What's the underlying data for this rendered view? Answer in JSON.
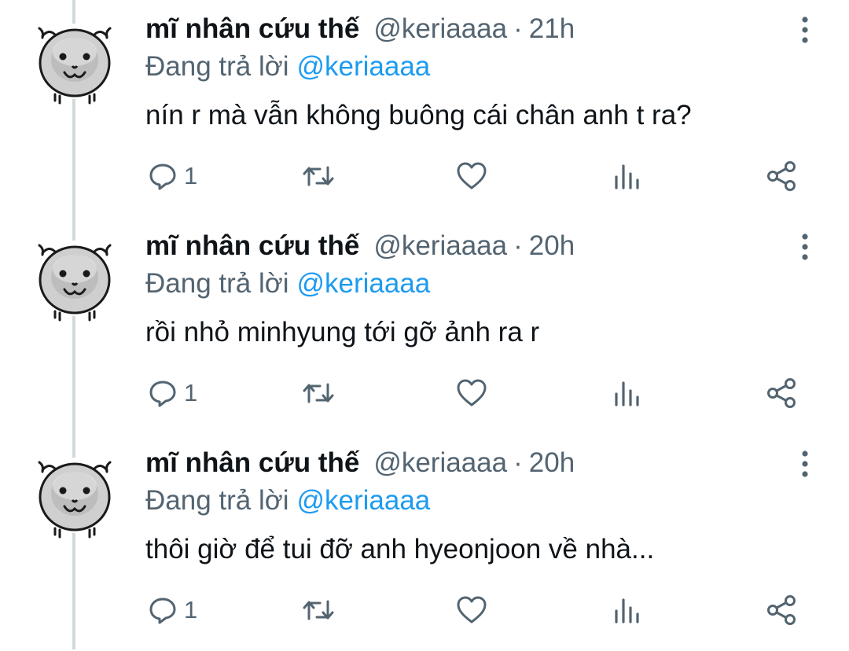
{
  "colors": {
    "text": "#0f1419",
    "secondary": "#536471",
    "mention": "#1d9bf0",
    "thread_line": "#cfd9de"
  },
  "icons": [
    "avatar-cat-icon",
    "more-vertical-icon",
    "reply-icon",
    "retweet-icon",
    "like-icon",
    "views-icon",
    "share-icon"
  ],
  "tweets": [
    {
      "name": "mĩ nhân cứu thế",
      "handle": "@keriaaaa",
      "time": "21h",
      "reply_prefix": "Đang trả lời",
      "reply_handle": "@keriaaaa",
      "text": "nín r mà vẫn không buông cái chân anh t ra?",
      "reply_count": "1"
    },
    {
      "name": "mĩ nhân cứu thế",
      "handle": "@keriaaaa",
      "time": "20h",
      "reply_prefix": "Đang trả lời",
      "reply_handle": "@keriaaaa",
      "text": "rồi nhỏ minhyung tới gỡ ảnh ra r",
      "reply_count": "1"
    },
    {
      "name": "mĩ nhân cứu thế",
      "handle": "@keriaaaa",
      "time": "20h",
      "reply_prefix": "Đang trả lời",
      "reply_handle": "@keriaaaa",
      "text": "thôi giờ để tui đỡ anh hyeonjoon về nhà...",
      "reply_count": "1"
    }
  ]
}
